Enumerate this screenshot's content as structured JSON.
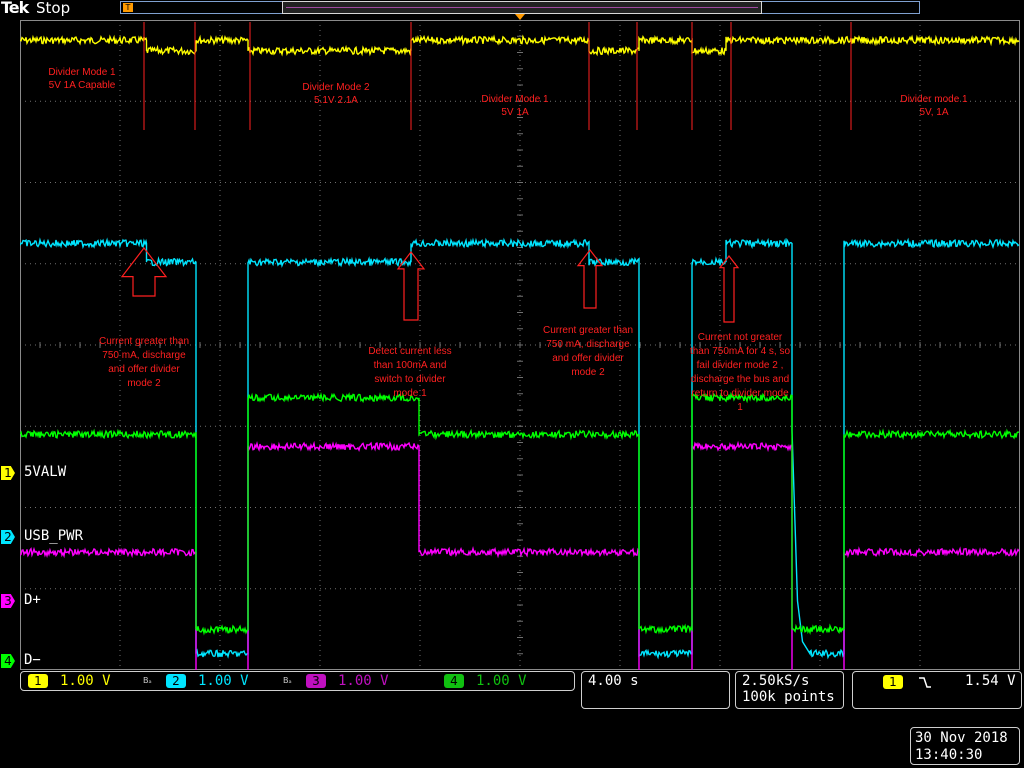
{
  "header": {
    "brand": "Tek",
    "run_status": "Stop",
    "trigger_marker_label": "T"
  },
  "colors": {
    "ch1": "#ffff00",
    "ch2": "#00e5ff",
    "ch3": "#ff00ff",
    "ch4": "#00ff00",
    "annotation": "#ff2020",
    "grid": "#707070",
    "frame": "#8a8a8a"
  },
  "channels": [
    {
      "num": "1",
      "name": "5VALW",
      "color": "#ffff00"
    },
    {
      "num": "2",
      "name": "USB_PWR",
      "color": "#00e5ff"
    },
    {
      "num": "3",
      "name": "D+",
      "color": "#ff00ff"
    },
    {
      "num": "4",
      "name": "D−",
      "color": "#00ff00"
    }
  ],
  "status": {
    "ch1_scale": "1.00 V",
    "ch2_scale": "1.00 V",
    "ch3_scale": "1.00 V",
    "ch4_scale": "1.00 V",
    "bw_mark": "Bₐ",
    "timebase": "4.00 s",
    "sample_rate": "2.50kS/s",
    "record_length": "100k points",
    "trigger_channel": "1",
    "trigger_slope_icon": "falling-edge-icon",
    "trigger_level": "1.54 V",
    "date": "30 Nov 2018",
    "time": "13:40:30"
  },
  "annotations": {
    "modes": [
      {
        "line1": "Divider Mode 1",
        "line2": "5V 1A Capable"
      },
      {
        "line1": "Divider Mode 2",
        "line2": "5.1V 2.1A"
      },
      {
        "line1": "Divider Mode 1",
        "line2": "5V 1A"
      },
      {
        "line1": "Divider mode 1",
        "line2": "5V, 1A"
      }
    ],
    "notes": [
      [
        "Current greater than",
        "750 mA, discharge",
        "and offer divider",
        "mode 2"
      ],
      [
        "Detect current less",
        "than 100mA and",
        "switch to divider",
        "mode 1"
      ],
      [
        "Current greater than",
        "750 mA, discharge",
        "and offer divider",
        "mode 2"
      ],
      [
        "Current not greater",
        "than 750mA for 4 s, so",
        "fail divider mode 2 ,",
        "discharge the bus and",
        "return to divider mode",
        "1"
      ]
    ]
  },
  "chart_data": {
    "type": "line",
    "title": "",
    "xlabel": "",
    "ylabel": "",
    "x_units": "s",
    "x_divisions": 10,
    "y_divisions": 8,
    "time_per_div_s": 4.0,
    "volts_per_div": 1.0,
    "xlim": [
      -20,
      20
    ],
    "grid": true,
    "series": [
      {
        "name": "5VALW",
        "channel": 1,
        "points": [
          [
            -20,
            5.0
          ],
          [
            -14.94,
            5.0
          ],
          [
            -14.94,
            4.87
          ],
          [
            -12.96,
            4.87
          ],
          [
            -12.96,
            5.0
          ],
          [
            -10.88,
            5.0
          ],
          [
            -10.88,
            4.87
          ],
          [
            -4.36,
            4.87
          ],
          [
            -4.36,
            5.0
          ],
          [
            2.76,
            5.0
          ],
          [
            2.76,
            4.87
          ],
          [
            4.76,
            4.87
          ],
          [
            4.76,
            5.0
          ],
          [
            6.88,
            5.0
          ],
          [
            6.88,
            4.87
          ],
          [
            8.24,
            4.87
          ],
          [
            8.24,
            5.0
          ],
          [
            20,
            5.0
          ]
        ]
      },
      {
        "name": "USB_PWR",
        "channel": 2,
        "points": [
          [
            -20,
            5.1
          ],
          [
            -14.94,
            5.1
          ],
          [
            -14.94,
            4.87
          ],
          [
            -12.96,
            4.87
          ],
          [
            -12.96,
            0.05
          ],
          [
            -10.88,
            0.05
          ],
          [
            -10.88,
            4.87
          ],
          [
            -4.36,
            4.87
          ],
          [
            -4.36,
            5.1
          ],
          [
            2.76,
            5.1
          ],
          [
            2.76,
            4.87
          ],
          [
            4.76,
            4.87
          ],
          [
            4.76,
            0.05
          ],
          [
            6.88,
            0.05
          ],
          [
            6.88,
            4.87
          ],
          [
            8.24,
            4.87
          ],
          [
            8.24,
            5.1
          ],
          [
            10.88,
            5.1
          ],
          [
            10.88,
            2.8
          ],
          [
            11.1,
            0.7
          ],
          [
            11.3,
            0.2
          ],
          [
            11.6,
            0.05
          ],
          [
            12.96,
            0.05
          ],
          [
            12.96,
            5.1
          ],
          [
            20,
            5.1
          ]
        ]
      },
      {
        "name": "D+",
        "channel": 3,
        "points": [
          [
            -20,
            0.6
          ],
          [
            -12.96,
            0.6
          ],
          [
            -12.96,
            -1.05
          ],
          [
            -10.88,
            -1.05
          ],
          [
            -10.88,
            1.9
          ],
          [
            -4.04,
            1.9
          ],
          [
            -4.04,
            0.6
          ],
          [
            4.76,
            0.6
          ],
          [
            4.76,
            -1.05
          ],
          [
            6.88,
            -1.05
          ],
          [
            6.88,
            1.9
          ],
          [
            10.88,
            1.9
          ],
          [
            10.88,
            -1.05
          ],
          [
            12.96,
            -1.05
          ],
          [
            12.96,
            0.6
          ],
          [
            20,
            0.6
          ]
        ]
      },
      {
        "name": "D−",
        "channel": 4,
        "points": [
          [
            -20,
            0.4
          ],
          [
            -12.96,
            0.4
          ],
          [
            -12.96,
            -2.0
          ],
          [
            -10.88,
            -2.0
          ],
          [
            -10.88,
            0.85
          ],
          [
            -4.04,
            0.85
          ],
          [
            -4.04,
            0.4
          ],
          [
            4.76,
            0.4
          ],
          [
            4.76,
            -2.0
          ],
          [
            6.88,
            -2.0
          ],
          [
            6.88,
            0.85
          ],
          [
            10.88,
            0.85
          ],
          [
            10.88,
            -2.0
          ],
          [
            12.96,
            -2.0
          ],
          [
            12.96,
            0.4
          ],
          [
            20,
            0.4
          ]
        ]
      }
    ]
  }
}
